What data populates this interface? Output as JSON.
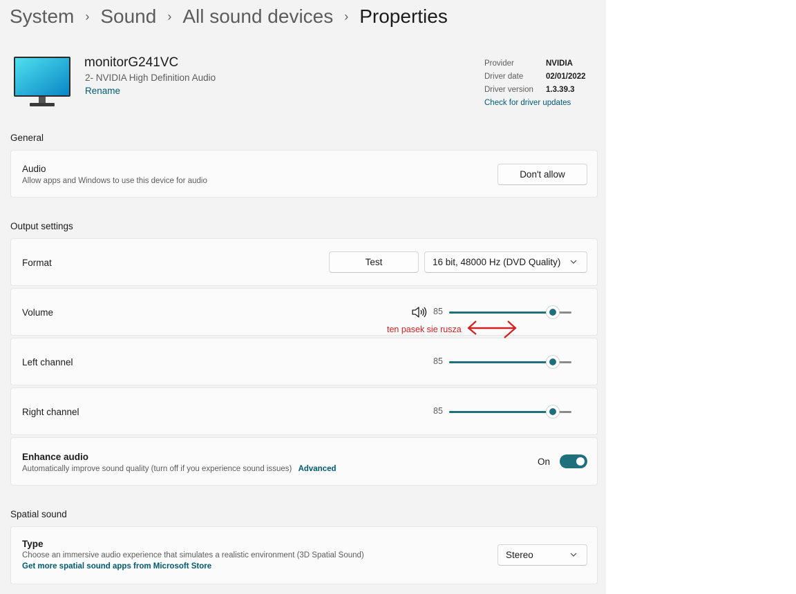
{
  "breadcrumb": {
    "items": [
      "System",
      "Sound",
      "All sound devices"
    ],
    "current": "Properties",
    "separator": "›"
  },
  "device": {
    "name": "monitorG241VC",
    "subtitle": "2- NVIDIA High Definition Audio",
    "rename": "Rename",
    "icon": "monitor-icon"
  },
  "driver": {
    "provider_label": "Provider",
    "provider_value": "NVIDIA",
    "date_label": "Driver date",
    "date_value": "02/01/2022",
    "version_label": "Driver version",
    "version_value": "1.3.39.3",
    "update_link": "Check for driver updates"
  },
  "general": {
    "title": "General",
    "audio_label": "Audio",
    "audio_desc": "Allow apps and Windows to use this device for audio",
    "audio_button": "Don't allow"
  },
  "output": {
    "title": "Output settings",
    "format_label": "Format",
    "test_button": "Test",
    "format_value": "16 bit, 48000 Hz (DVD Quality)",
    "volume_label": "Volume",
    "volume_value": "85",
    "volume_fraction": 0.85,
    "left_label": "Left channel",
    "left_value": "85",
    "left_fraction": 0.85,
    "right_label": "Right channel",
    "right_value": "85",
    "right_fraction": 0.85,
    "enhance_label": "Enhance audio",
    "enhance_desc": "Automatically improve sound quality (turn off if you experience sound issues)",
    "enhance_advanced": "Advanced",
    "enhance_state": "On"
  },
  "annotation": {
    "text": "ten pasek sie rusza",
    "color": "#d22020"
  },
  "spatial": {
    "title": "Spatial sound",
    "type_label": "Type",
    "type_desc": "Choose an immersive audio experience that simulates a realistic environment (3D Spatial Sound)",
    "store_link": "Get more spatial sound apps from Microsoft Store",
    "type_value": "Stereo"
  },
  "colors": {
    "accent": "#1f6f7d",
    "link": "#005a70",
    "background": "#f3f3f3",
    "card": "#fbfbfb"
  }
}
